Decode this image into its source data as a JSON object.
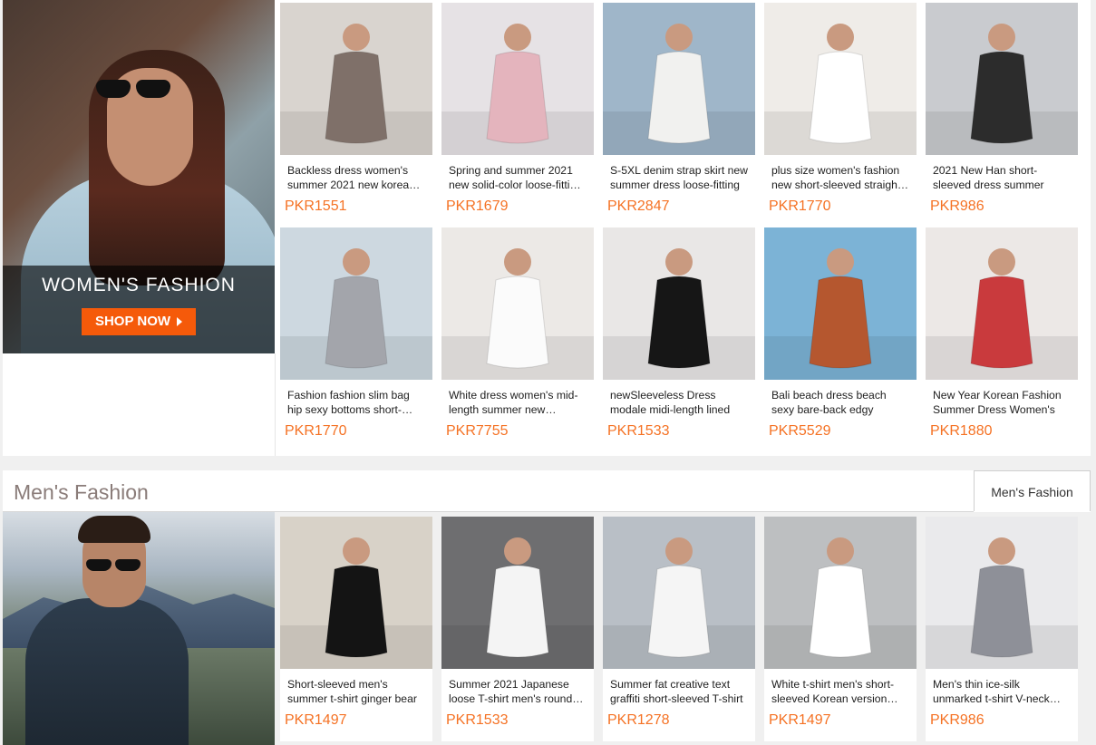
{
  "womens": {
    "banner_title": "WOMEN'S FASHION",
    "shop_now": "SHOP NOW",
    "products": [
      {
        "title": "Backless dress women's summer 2021 new korean style",
        "price": "PKR1551",
        "bg": "#d9d4cf",
        "fg": "#7f7069"
      },
      {
        "title": "Spring and summer 2021 new solid-color loose-fitting dress",
        "price": "PKR1679",
        "bg": "#e6e2e5",
        "fg": "#e4b4bd"
      },
      {
        "title": "S-5XL denim strap skirt new summer dress loose-fitting",
        "price": "PKR2847",
        "bg": "#9fb6c9",
        "fg": "#f1f1ef"
      },
      {
        "title": "plus size women's fashion new short-sleeved straight dress",
        "price": "PKR1770",
        "bg": "#efece8",
        "fg": "#ffffff"
      },
      {
        "title": "2021 New Han short-sleeved dress summer",
        "price": "PKR986",
        "bg": "#c9cbcf",
        "fg": "#2c2c2c"
      },
      {
        "title": "Fashion fashion slim bag hip sexy bottoms short-sleeved",
        "price": "PKR1770",
        "bg": "#cdd8e0",
        "fg": "#a3a5ab"
      },
      {
        "title": "White dress women's mid-length summer new drawstring",
        "price": "PKR7755",
        "bg": "#ece9e6",
        "fg": "#fbfbfb"
      },
      {
        "title": "newSleeveless Dress modale midi-length lined",
        "price": "PKR1533",
        "bg": "#e9e7e6",
        "fg": "#161616"
      },
      {
        "title": "Bali beach dress beach sexy bare-back edgy",
        "price": "PKR5529",
        "bg": "#7cb3d6",
        "fg": "#b5572f"
      },
      {
        "title": "New Year Korean Fashion Summer Dress Women's",
        "price": "PKR1880",
        "bg": "#ece8e6",
        "fg": "#c93a3d"
      }
    ]
  },
  "mens": {
    "section_title": "Men's Fashion",
    "tab_label": "Men's Fashion",
    "products": [
      {
        "title": "Short-sleeved men's summer t-shirt ginger bear",
        "price": "PKR1497",
        "bg": "#d8d2c8",
        "fg": "#141414"
      },
      {
        "title": "Summer 2021 Japanese loose T-shirt men's round neck",
        "price": "PKR1533",
        "bg": "#6e6e70",
        "fg": "#f4f4f4"
      },
      {
        "title": "Summer fat creative text graffiti short-sleeved T-shirt",
        "price": "PKR1278",
        "bg": "#b9bfc6",
        "fg": "#f5f5f5"
      },
      {
        "title": "White t-shirt men's short-sleeved Korean version slim",
        "price": "PKR1497",
        "bg": "#bdbfc1",
        "fg": "#ffffff"
      },
      {
        "title": "Men's thin ice-silk unmarked t-shirt V-neck short",
        "price": "PKR986",
        "bg": "#eaeaec",
        "fg": "#8e9098"
      }
    ]
  }
}
